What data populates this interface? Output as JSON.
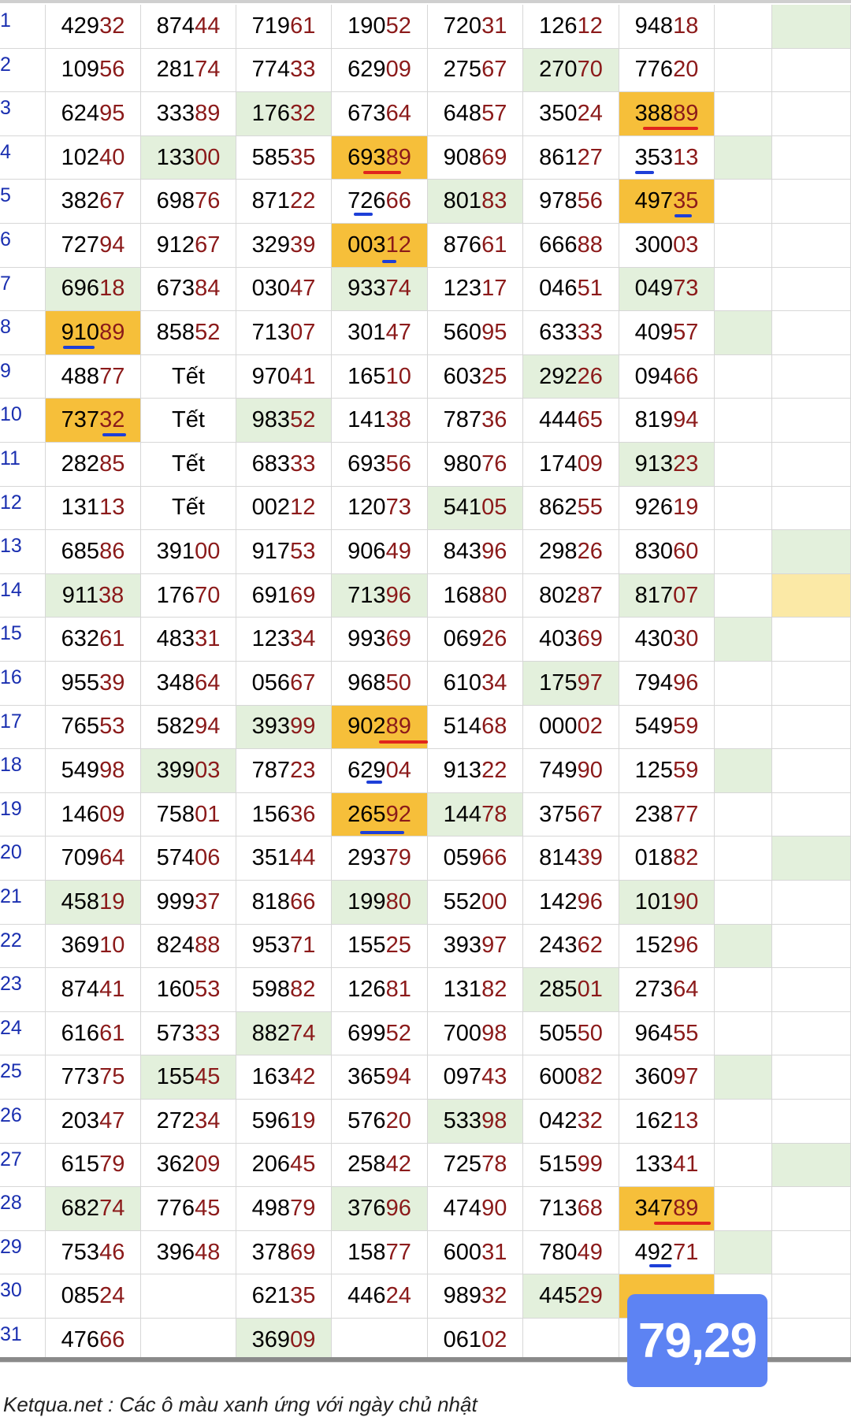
{
  "table": {
    "rows": [
      {
        "label": "1",
        "cells": [
          "42932",
          "87444",
          "71961",
          "19052",
          "72031",
          "12612",
          "94818"
        ]
      },
      {
        "label": "2",
        "cells": [
          "10956",
          "28174",
          "77433",
          "62909",
          "27567",
          "27070",
          "77620"
        ]
      },
      {
        "label": "3",
        "cells": [
          "62495",
          "33389",
          "17632",
          "67364",
          "64857",
          "35024",
          "38889"
        ]
      },
      {
        "label": "4",
        "cells": [
          "10240",
          "13300",
          "58535",
          "69389",
          "90869",
          "86127",
          "35313"
        ]
      },
      {
        "label": "5",
        "cells": [
          "38267",
          "69876",
          "87122",
          "72666",
          "80183",
          "97856",
          "49735"
        ]
      },
      {
        "label": "6",
        "cells": [
          "72794",
          "91267",
          "32939",
          "00312",
          "87661",
          "66688",
          "30003"
        ]
      },
      {
        "label": "7",
        "cells": [
          "69618",
          "67384",
          "03047",
          "93374",
          "12317",
          "04651",
          "04973"
        ]
      },
      {
        "label": "8",
        "cells": [
          "91089",
          "85852",
          "71307",
          "30147",
          "56095",
          "63333",
          "40957"
        ]
      },
      {
        "label": "9",
        "cells": [
          "48877",
          "Tết",
          "97041",
          "16510",
          "60325",
          "29226",
          "09466"
        ]
      },
      {
        "label": "10",
        "cells": [
          "73732",
          "Tết",
          "98352",
          "14138",
          "78736",
          "44465",
          "81994"
        ]
      },
      {
        "label": "11",
        "cells": [
          "28285",
          "Tết",
          "68333",
          "69356",
          "98076",
          "17409",
          "91323"
        ]
      },
      {
        "label": "12",
        "cells": [
          "13113",
          "Tết",
          "00212",
          "12073",
          "54105",
          "86255",
          "92619"
        ]
      },
      {
        "label": "13",
        "cells": [
          "68586",
          "39100",
          "91753",
          "90649",
          "84396",
          "29826",
          "83060"
        ]
      },
      {
        "label": "14",
        "cells": [
          "91138",
          "17670",
          "69169",
          "71396",
          "16880",
          "80287",
          "81707"
        ]
      },
      {
        "label": "15",
        "cells": [
          "63261",
          "48331",
          "12334",
          "99369",
          "06926",
          "40369",
          "43030"
        ]
      },
      {
        "label": "16",
        "cells": [
          "95539",
          "34864",
          "05667",
          "96850",
          "61034",
          "17597",
          "79496"
        ]
      },
      {
        "label": "17",
        "cells": [
          "76553",
          "58294",
          "39399",
          "90289",
          "51468",
          "00002",
          "54959"
        ]
      },
      {
        "label": "18",
        "cells": [
          "54998",
          "39903",
          "78723",
          "62904",
          "91322",
          "74990",
          "12559"
        ]
      },
      {
        "label": "19",
        "cells": [
          "14609",
          "75801",
          "15636",
          "26592",
          "14478",
          "37567",
          "23877"
        ]
      },
      {
        "label": "20",
        "cells": [
          "70964",
          "57406",
          "35144",
          "29379",
          "05966",
          "81439",
          "01882"
        ]
      },
      {
        "label": "21",
        "cells": [
          "45819",
          "99937",
          "81866",
          "19980",
          "55200",
          "14296",
          "10190"
        ]
      },
      {
        "label": "22",
        "cells": [
          "36910",
          "82488",
          "95371",
          "15525",
          "39397",
          "24362",
          "15296"
        ]
      },
      {
        "label": "23",
        "cells": [
          "87441",
          "16053",
          "59882",
          "12681",
          "13182",
          "28501",
          "27364"
        ]
      },
      {
        "label": "24",
        "cells": [
          "61661",
          "57333",
          "88274",
          "69952",
          "70098",
          "50550",
          "96455"
        ]
      },
      {
        "label": "25",
        "cells": [
          "77375",
          "15545",
          "16342",
          "36594",
          "09743",
          "60082",
          "36097"
        ]
      },
      {
        "label": "26",
        "cells": [
          "20347",
          "27234",
          "59619",
          "57620",
          "53398",
          "04232",
          "16213"
        ]
      },
      {
        "label": "27",
        "cells": [
          "61579",
          "36209",
          "20645",
          "25842",
          "72578",
          "51599",
          "13341"
        ]
      },
      {
        "label": "28",
        "cells": [
          "68274",
          "77645",
          "49879",
          "37696",
          "47490",
          "71368",
          "34789"
        ]
      },
      {
        "label": "29",
        "cells": [
          "75346",
          "39648",
          "37869",
          "15877",
          "60031",
          "78049",
          "49271"
        ]
      },
      {
        "label": "30",
        "cells": [
          "08524",
          "",
          "62135",
          "44624",
          "98932",
          "44529",
          ""
        ]
      },
      {
        "label": "31",
        "cells": [
          "47666",
          "",
          "36909",
          "",
          "06102",
          "",
          ""
        ]
      }
    ]
  },
  "colors": {
    "sunday_green": "#e3f0dc",
    "highlight_orange": "#f6bf3a",
    "highlight_yellow": "#fbe9a6",
    "row_label_blue": "#1a2fb0",
    "digit_tail_red": "#8b1a1a",
    "mark_red": "#e0241c",
    "mark_blue": "#1d3fd8",
    "badge_blue": "#5d83f3"
  },
  "badge": {
    "text": "79,29"
  },
  "footer": {
    "note": "Ketqua.net : Các ô màu xanh ứng với ngày chủ nhật"
  }
}
